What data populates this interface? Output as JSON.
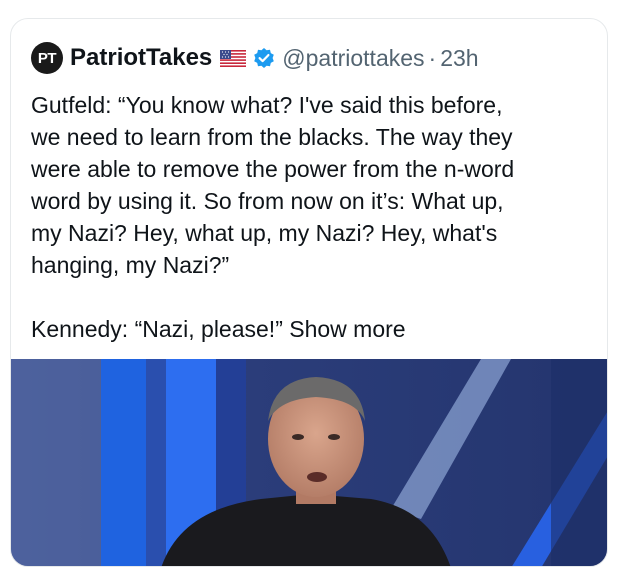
{
  "post": {
    "avatar_text": "PT",
    "author_name": "PatriotTakes",
    "flag_icon": "us-flag-icon",
    "verified_icon": "verified-badge-icon",
    "handle": "@patriottakes",
    "separator": "·",
    "time": "23h",
    "text_lines": [
      "Gutfeld: “You know what? I've said this before,",
      "we need to learn from the blacks. The way they",
      "were able to remove the power from the n-word",
      "word by using it. So from now on it’s: What up,",
      "my Nazi? Hey, what up, my Nazi? Hey, what's",
      "hanging, my Nazi?”"
    ],
    "second_paragraph": "Kennedy: “Nazi, please!”",
    "show_more": "Show more"
  },
  "colors": {
    "text": "#0f1419",
    "muted": "#536471",
    "verified": "#1d9bf0",
    "studio_blue": "#1e5fd0"
  }
}
